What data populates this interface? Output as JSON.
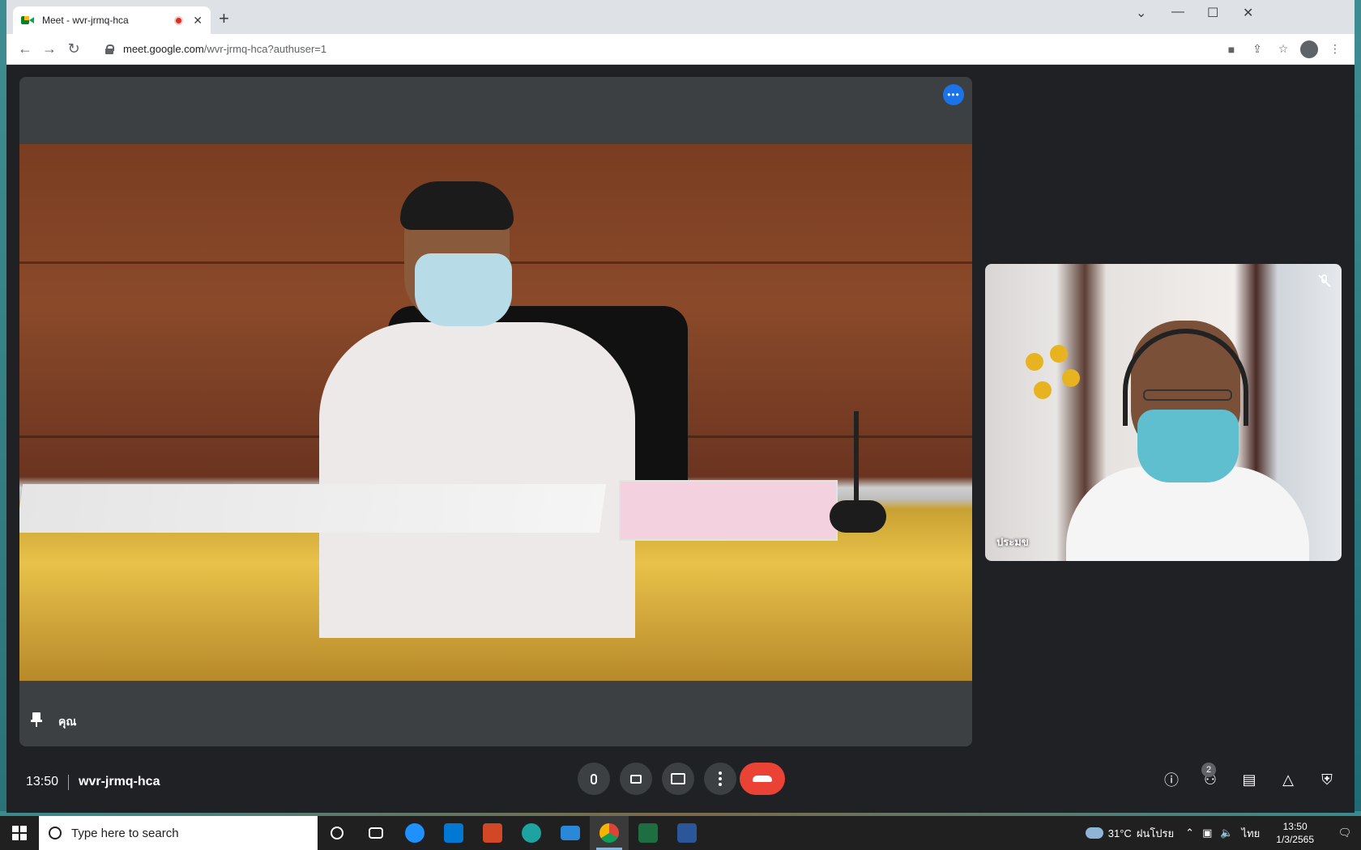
{
  "browser": {
    "tab_title": "Meet - wvr-jrmq-hca",
    "url_host": "meet.google.com",
    "url_path": "/wvr-jrmq-hca?authuser=1",
    "new_tab": "+"
  },
  "main_tile": {
    "participant_name": "คุณ"
  },
  "side_tile": {
    "participant_name": "ประมข"
  },
  "controls": {
    "time": "13:50",
    "meeting_code": "wvr-jrmq-hca",
    "participants_badge": "2"
  },
  "taskbar": {
    "search_placeholder": "Type here to search",
    "temperature": "31°C",
    "weather_text": "ฝนโปรย",
    "language": "ไทย",
    "time": "13:50",
    "date": "1/3/2565"
  },
  "colors": {
    "meet_bg": "#202124",
    "tile_bg": "#3c4043",
    "hangup": "#ea4335",
    "accent": "#1a73e8"
  }
}
